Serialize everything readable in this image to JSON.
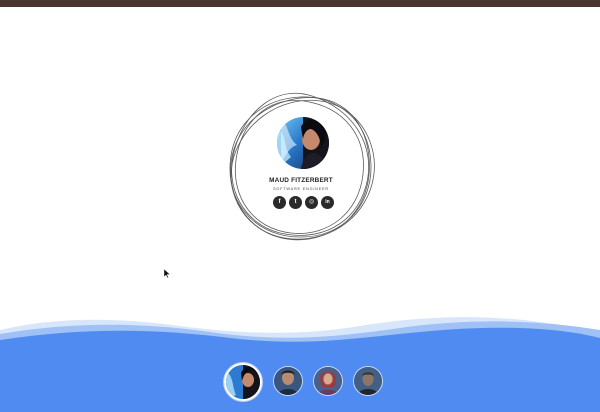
{
  "profile": {
    "name": "MAUD FITZERBERT",
    "title": "SOFTWARE ENGINEER",
    "avatar": "portrait-photo"
  },
  "social": [
    {
      "icon": "facebook-icon",
      "glyph": "f"
    },
    {
      "icon": "twitter-icon",
      "glyph": "t"
    },
    {
      "icon": "instagram-icon",
      "glyph": "◎"
    },
    {
      "icon": "linkedin-icon",
      "glyph": "in"
    }
  ],
  "thumbnails": [
    {
      "name": "profile-1",
      "active": true
    },
    {
      "name": "profile-2",
      "active": false
    },
    {
      "name": "profile-3",
      "active": false
    },
    {
      "name": "profile-4",
      "active": false
    }
  ],
  "colors": {
    "top_bar": "#4a3530",
    "wave_light": "#d8e6fb",
    "wave_mid": "#9fc1f6",
    "wave_dark": "#4f8bf1",
    "social_bg": "#2a2a2a",
    "ring_stroke": "#5b5b5b"
  }
}
